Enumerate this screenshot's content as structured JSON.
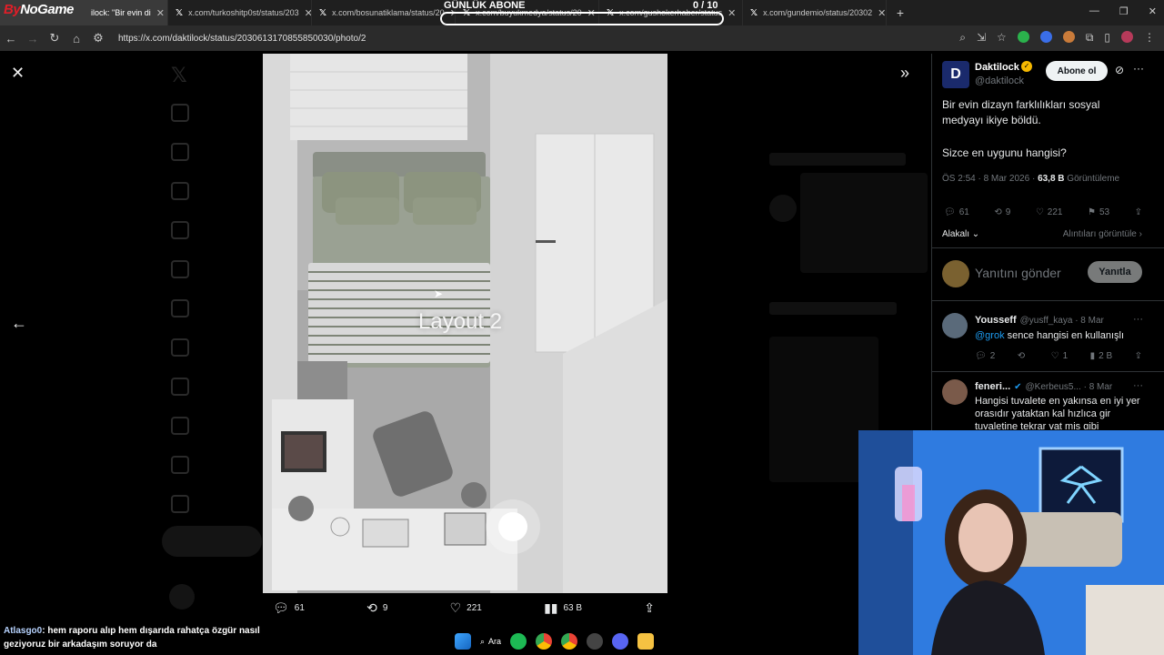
{
  "stream_overlay": {
    "brand_prefix": "By",
    "brand_suffix": "NoGame",
    "subscriber_goal_label": "GÜNLÜK ABONE",
    "subscriber_goal_count": "0 / 10",
    "chat_user": "Atlasgo0",
    "chat_message": ": hem raporu alıp hem dışarıda rahatça özgür nasıl geziyoruz bir arkadaşım soruyor da"
  },
  "browser": {
    "tabs": [
      {
        "label": "ilock: \"Bir evin di",
        "active": true
      },
      {
        "label": "x.com/turkoshitp0st/status/203",
        "active": false
      },
      {
        "label": "x.com/bosunatiklama/status/20",
        "active": false
      },
      {
        "label": "x.com/buyukmedya/status/20",
        "active": false
      },
      {
        "label": "x.com/gushokerhaber/status",
        "active": false
      },
      {
        "label": "x.com/gundemio/status/20302",
        "active": false
      }
    ],
    "new_tab": "+",
    "url": "https://x.com/daktilock/status/2030613170855850030/photo/2"
  },
  "media": {
    "overlay_label": "Layout 2",
    "replies": "61",
    "reposts": "9",
    "likes": "221",
    "views": "63 B"
  },
  "tweet": {
    "author_name": "Daktilock",
    "author_handle": "@daktilock",
    "avatar_letter": "D",
    "follow_label": "Abone ol",
    "text_line1": "Bir evin dizayn farklılıkları sosyal medyayı ikiye böldü.",
    "text_line2": "Sizce en uygunu hangisi?",
    "time": "ÖS 2:54 · 8 Mar 2026 · ",
    "views": "63,8 B",
    "views_label": " Görüntüleme",
    "replies": "61",
    "reposts": "9",
    "likes": "221",
    "bookmarks": "53",
    "sort_label": "Alakalı",
    "quotes_label": "Alıntıları görüntüle",
    "reply_placeholder": "Yanıtını gönder",
    "reply_button": "Yanıtla"
  },
  "replies": [
    {
      "name": "Yousseff",
      "handle": "@yusff_kaya · 8 Mar",
      "mention": "@grok",
      "text": " sence hangisi en kullanışlı",
      "replies": "2",
      "reposts": "",
      "likes": "1",
      "views": "2 B"
    },
    {
      "name": "feneri...",
      "handle": "@Kerbeus5... · 8 Mar",
      "text": "Hangisi tuvalete en yakınsa en iyi yer orasıdır yataktan kal hızlıca gir tuvaletine tekrar yat miş gibi"
    }
  ],
  "taskbar": {
    "search_label": "Ara"
  },
  "colors": {
    "accent": "#1d9bf0",
    "background": "#000000",
    "verified_gold": "#f5b800"
  }
}
